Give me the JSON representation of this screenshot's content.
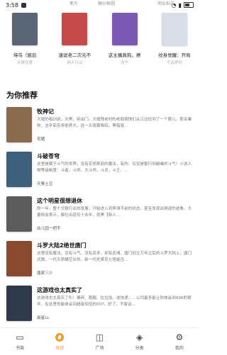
{
  "status": {
    "time": "3:58"
  },
  "overlay": [
    "素片",
    "糖纱框圆",
    "明似稻云"
  ],
  "top_books": [
    {
      "title": "侍鸟（姐后",
      "author": "无聊苦度",
      "cover_color": "#5a6575"
    },
    {
      "title": "速说老二次元不",
      "author": "网人行山",
      "cover_color": "#c54a4a"
    },
    {
      "title": "这主播真狗，撩",
      "author": "吉午",
      "cover_color": "#7a5ab5"
    },
    {
      "title": "纹身觉醒：开局",
      "author": "千古奇何",
      "cover_color": "#d9dde8"
    }
  ],
  "section": {
    "title": "为你推荐"
  },
  "books": [
    {
      "title": "牧神记",
      "desc": "大墟的祖训说，天黑，别出门。大墟残老村的老弱病残们从江边捡到了一个婴儿，取名秦牧，含辛茹苦将他养大。这一天夜幕降临，黑暗笼…",
      "author": "宅猪",
      "cover_color": "#8a6b4d"
    },
    {
      "title": "斗破苍穹",
      "desc": "这里是属于斗气的世界，没有花俏艳丽的魔法，有的，仅仅是繁衍到巅峰的斗气！小说人物等级制度：斗者，斗师，大斗师，斗灵，斗王，…",
      "author": "天蚕土豆",
      "cover_color": "#3d5f7a"
    },
    {
      "title": "这个明星很想退休",
      "desc": "即一年，整个文娱行业的发展，开始进入到停滞不前的状态，甚至发现出倒退的迹象。大量网友表示，都位出道仅十余年，就黑【新人…",
      "author": "幼儿园一把手",
      "cover_color": "#5c5c5c"
    },
    {
      "title": "斗罗大陆2绝世唐门",
      "desc": "这里没有魔法，没有斗气，没有武术，却有武魂。唐门创立万年之后的斗罗大陆上，唐门式微。一代天骄横空出世，新一代史莱克七怪能否…",
      "author": "唐家三少",
      "cover_color": "#8a4a2f"
    },
    {
      "title": "这游戏也太真实了",
      "desc": "这游戏也太真实了叭！撕碎、跑腿、拉垃圾、送快递……公司最多能让你体会到996的艰辛，在这里你能体会到超级加倍的007。好了，不废话…",
      "author": "晨星LL",
      "cover_color": "#2f3a4a"
    }
  ],
  "tabs": [
    {
      "label": "书架",
      "icon": "bookshelf-icon",
      "glyph": "▭"
    },
    {
      "label": "发现",
      "icon": "compass-icon",
      "glyph": ""
    },
    {
      "label": "广场",
      "icon": "square-icon",
      "glyph": "◫"
    },
    {
      "label": "分类",
      "icon": "layers-icon",
      "glyph": "◈"
    },
    {
      "label": "我的",
      "icon": "gear-icon",
      "glyph": "⚙"
    }
  ],
  "accent": "#f39a2b"
}
